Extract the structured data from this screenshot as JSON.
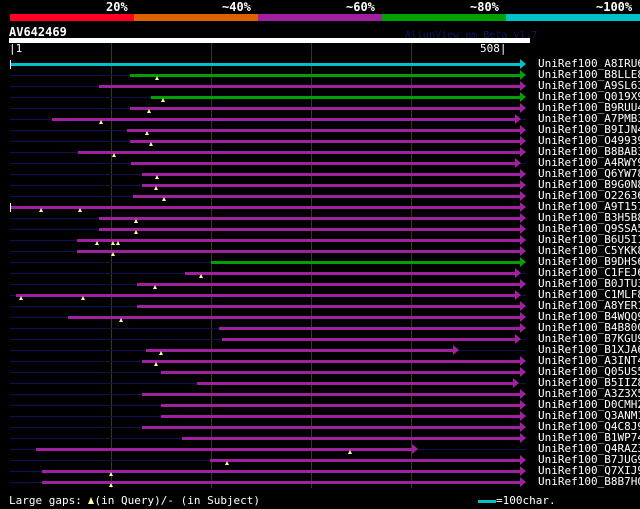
{
  "legend_bands": [
    {
      "label": "20%",
      "color": "#ff0022"
    },
    {
      "label": "~40%",
      "color": "#e06000"
    },
    {
      "label": "~60%",
      "color": "#a020a0"
    },
    {
      "label": "~80%",
      "color": "#00a000"
    },
    {
      "label": "~100%",
      "color": "#00c0c8"
    }
  ],
  "query": {
    "id": "AV642469",
    "start": "1",
    "end": "508",
    "length": 508
  },
  "version": "AlignView.pm Beta v1.7",
  "hits": [
    {
      "name": "UniRef100_A8IRU6",
      "s": 1,
      "e": 508,
      "c": "#00c0c8",
      "gaps": []
    },
    {
      "name": "UniRef100_B8LLE8",
      "s": 120,
      "e": 508,
      "c": "#00a000",
      "gaps": [
        147
      ]
    },
    {
      "name": "UniRef100_A9SL63",
      "s": 89,
      "e": 508,
      "c": "#a020a0",
      "gaps": []
    },
    {
      "name": "UniRef100_Q019X9",
      "s": 141,
      "e": 508,
      "c": "#00a000",
      "gaps": [
        153
      ]
    },
    {
      "name": "UniRef100_B9RUU4",
      "s": 120,
      "e": 508,
      "c": "#a020a0",
      "gaps": [
        139
      ]
    },
    {
      "name": "UniRef100_A7PMB3",
      "s": 43,
      "e": 503,
      "c": "#a020a0",
      "gaps": [
        91
      ]
    },
    {
      "name": "UniRef100_B9IJN4",
      "s": 117,
      "e": 508,
      "c": "#a020a0",
      "gaps": [
        137
      ]
    },
    {
      "name": "UniRef100_O49939",
      "s": 120,
      "e": 508,
      "c": "#a020a0",
      "gaps": [
        141
      ]
    },
    {
      "name": "UniRef100_B8BAB3",
      "s": 69,
      "e": 508,
      "c": "#a020a0",
      "gaps": [
        104
      ]
    },
    {
      "name": "UniRef100_A4RWY9",
      "s": 121,
      "e": 503,
      "c": "#a020a0",
      "gaps": []
    },
    {
      "name": "UniRef100_Q6YW78",
      "s": 132,
      "e": 508,
      "c": "#a020a0",
      "gaps": [
        147
      ]
    },
    {
      "name": "UniRef100_B9G0N8",
      "s": 132,
      "e": 508,
      "c": "#a020a0",
      "gaps": [
        146
      ]
    },
    {
      "name": "UniRef100_O22636",
      "s": 123,
      "e": 508,
      "c": "#a020a0",
      "gaps": [
        154
      ]
    },
    {
      "name": "UniRef100_A9T157",
      "s": 1,
      "e": 508,
      "c": "#a020a0",
      "gaps": [
        32,
        71
      ]
    },
    {
      "name": "UniRef100_B3H5B8",
      "s": 89,
      "e": 508,
      "c": "#a020a0",
      "gaps": [
        126
      ]
    },
    {
      "name": "UniRef100_Q9SSA5",
      "s": 89,
      "e": 508,
      "c": "#a020a0",
      "gaps": [
        126
      ]
    },
    {
      "name": "UniRef100_B6U5I1",
      "s": 68,
      "e": 508,
      "c": "#a020a0",
      "gaps": [
        87,
        103,
        108
      ]
    },
    {
      "name": "UniRef100_C5YKK8",
      "s": 68,
      "e": 508,
      "c": "#a020a0",
      "gaps": [
        103
      ]
    },
    {
      "name": "UniRef100_B9DHS6",
      "s": 201,
      "e": 508,
      "c": "#00a000",
      "gaps": []
    },
    {
      "name": "UniRef100_C1FEJ6",
      "s": 175,
      "e": 503,
      "c": "#a020a0",
      "gaps": [
        191
      ]
    },
    {
      "name": "UniRef100_B0JTU3",
      "s": 127,
      "e": 508,
      "c": "#a020a0",
      "gaps": [
        145
      ]
    },
    {
      "name": "UniRef100_C1MLF8",
      "s": 7,
      "e": 503,
      "c": "#a020a0",
      "gaps": [
        12,
        74
      ]
    },
    {
      "name": "UniRef100_A8YER1",
      "s": 127,
      "e": 508,
      "c": "#a020a0",
      "gaps": []
    },
    {
      "name": "UniRef100_B4WQQ9",
      "s": 59,
      "e": 508,
      "c": "#a020a0",
      "gaps": [
        111
      ]
    },
    {
      "name": "UniRef100_B4B800",
      "s": 209,
      "e": 508,
      "c": "#a020a0",
      "gaps": []
    },
    {
      "name": "UniRef100_B7KGU9",
      "s": 212,
      "e": 503,
      "c": "#a020a0",
      "gaps": []
    },
    {
      "name": "UniRef100_B1XJA6",
      "s": 136,
      "e": 441,
      "c": "#a020a0",
      "gaps": [
        151
      ]
    },
    {
      "name": "UniRef100_A3INT4",
      "s": 132,
      "e": 508,
      "c": "#a020a0",
      "gaps": [
        146
      ]
    },
    {
      "name": "UniRef100_Q05US5",
      "s": 151,
      "e": 508,
      "c": "#a020a0",
      "gaps": []
    },
    {
      "name": "UniRef100_B5IIZ8",
      "s": 187,
      "e": 501,
      "c": "#a020a0",
      "gaps": []
    },
    {
      "name": "UniRef100_A3Z3X5",
      "s": 132,
      "e": 508,
      "c": "#a020a0",
      "gaps": []
    },
    {
      "name": "UniRef100_D0CMH2",
      "s": 151,
      "e": 508,
      "c": "#a020a0",
      "gaps": []
    },
    {
      "name": "UniRef100_Q3ANM1",
      "s": 151,
      "e": 508,
      "c": "#a020a0",
      "gaps": []
    },
    {
      "name": "UniRef100_Q4C8J9",
      "s": 132,
      "e": 508,
      "c": "#a020a0",
      "gaps": []
    },
    {
      "name": "UniRef100_B1WP74",
      "s": 172,
      "e": 508,
      "c": "#a020a0",
      "gaps": []
    },
    {
      "name": "UniRef100_Q4RAZ3",
      "s": 27,
      "e": 401,
      "c": "#a020a0",
      "gaps": [
        339
      ]
    },
    {
      "name": "UniRef100_B7JUG9",
      "s": 200,
      "e": 508,
      "c": "#a020a0",
      "gaps": [
        217
      ]
    },
    {
      "name": "UniRef100_Q7XIJ9",
      "s": 33,
      "e": 508,
      "c": "#a020a0",
      "gaps": [
        101
      ]
    },
    {
      "name": "UniRef100_B8B7H0",
      "s": 33,
      "e": 508,
      "c": "#a020a0",
      "gaps": [
        101
      ]
    }
  ],
  "footer": {
    "gaps_label": "Large gaps: ",
    "query_gap": "(in Query)/- (in Subject)",
    "scale": "=100char."
  }
}
